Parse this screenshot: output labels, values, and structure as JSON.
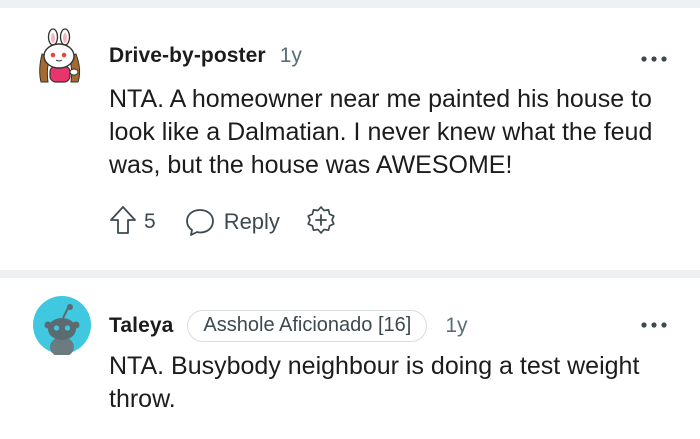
{
  "comments": [
    {
      "username": "Drive-by-poster",
      "time": "1y",
      "flair": "",
      "text": "NTA. A homeowner near me painted his house to look like a Dalmatian. I never knew what the feud was, but the house was AWESOME!",
      "score": "5",
      "reply_label": "Reply",
      "avatar_icon": "bunny-snoo-avatar-icon"
    },
    {
      "username": "Taleya",
      "time": "1y",
      "flair": "Asshole Aficionado [16]",
      "text": "NTA. Busybody neighbour is doing a test weight throw.",
      "avatar_icon": "snoo-avatar-icon"
    }
  ],
  "colors": {
    "text": "#1c1c1c",
    "meta": "#576f76",
    "icon": "#3c4a4f",
    "divider": "#eef0f1",
    "avatar_bg": "#3fc8e0"
  }
}
